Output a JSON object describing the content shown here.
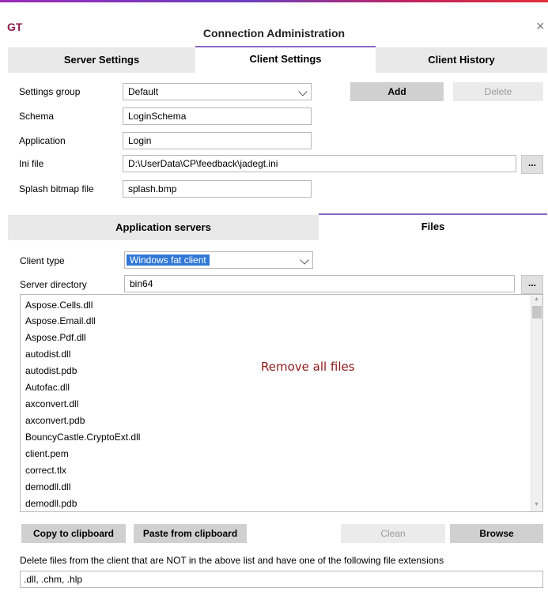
{
  "window": {
    "logo": "GT",
    "title": "Connection Administration",
    "close_glyph": "×"
  },
  "tabs": [
    "Server Settings",
    "Client Settings",
    "Client History"
  ],
  "settings": {
    "settings_group_label": "Settings group",
    "settings_group_value": "Default",
    "schema_label": "Schema",
    "schema_value": "LoginSchema",
    "application_label": "Application",
    "application_value": "Login",
    "ini_label": "Ini file",
    "ini_value": "D:\\UserData\\CP\\feedback\\jadegt.ini",
    "splash_label": "Splash bitmap file",
    "splash_value": "splash.bmp",
    "add_label": "Add",
    "delete_label": "Delete",
    "dots": "..."
  },
  "subtabs": [
    "Application servers",
    "Files"
  ],
  "files": {
    "client_type_label": "Client type",
    "client_type_value": "Windows fat client",
    "server_dir_label": "Server directory",
    "server_dir_value": "bin64",
    "dots": "...",
    "list": [
      "Aspose.Cells.dll",
      "Aspose.Email.dll",
      "Aspose.Pdf.dll",
      "autodist.dll",
      "autodist.pdb",
      "Autofac.dll",
      "axconvert.dll",
      "axconvert.pdb",
      "BouncyCastle.CryptoExt.dll",
      "client.pem",
      "correct.tlx",
      "demodll.dll",
      "demodll.pdb"
    ],
    "remove_all_text": "Remove all files",
    "copy_label": "Copy to clipboard",
    "paste_label": "Paste from clipboard",
    "clean_label": "Clean",
    "browse_label": "Browse",
    "delete_desc": "Delete files from the client that are NOT in the above list and have one of the following file extensions",
    "extensions": ".dll, .chm, .hlp"
  }
}
